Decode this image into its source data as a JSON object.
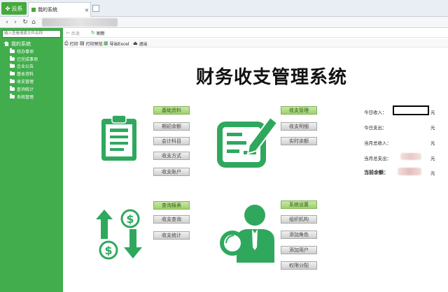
{
  "browser": {
    "start_label": "云系",
    "tab_label": "我的系统",
    "tab_close": "×"
  },
  "sidebar": {
    "search_placeholder": "输入查看搜索文件名称",
    "root_label": "我的系统",
    "items": [
      "待办事项",
      "已完成事项",
      "企业公告",
      "基本资料",
      "收支管理",
      "查询统计",
      "系统管理"
    ]
  },
  "toolbar1": {
    "back_label": "后退",
    "refresh_label": "刷新"
  },
  "toolbar2": {
    "print_label": "打印",
    "print_preview_label": "打印预览",
    "export_label": "导出Excel",
    "exit_label": "退出"
  },
  "title": "财务收支管理系统",
  "modules": {
    "basic": {
      "header": "基础资料",
      "items": [
        "期初余额",
        "会计科目",
        "收支方式",
        "收支账户"
      ]
    },
    "income": {
      "header": "收支管理",
      "items": [
        "收支明细",
        "实时余额"
      ]
    },
    "query": {
      "header": "查询报表",
      "items": [
        "收支查询",
        "收支统计"
      ]
    },
    "system": {
      "header": "系统设置",
      "items": [
        "组织机构",
        "添加角色",
        "添加用户",
        "权限分配"
      ]
    }
  },
  "stats": {
    "unit": "元",
    "rows": [
      {
        "label": "今日收入："
      },
      {
        "label": "今日支出："
      },
      {
        "label": "当月总收入："
      },
      {
        "label": "当月总支出："
      },
      {
        "label": "当前余额："
      }
    ]
  },
  "colors": {
    "sidebar": "#42ad4d",
    "icon_green": "#2fa85e",
    "header_btn": "#a8d67a"
  },
  "icons": [
    "clipboard-icon",
    "contract-pen-icon",
    "money-transfer-icon",
    "user-search-icon"
  ]
}
